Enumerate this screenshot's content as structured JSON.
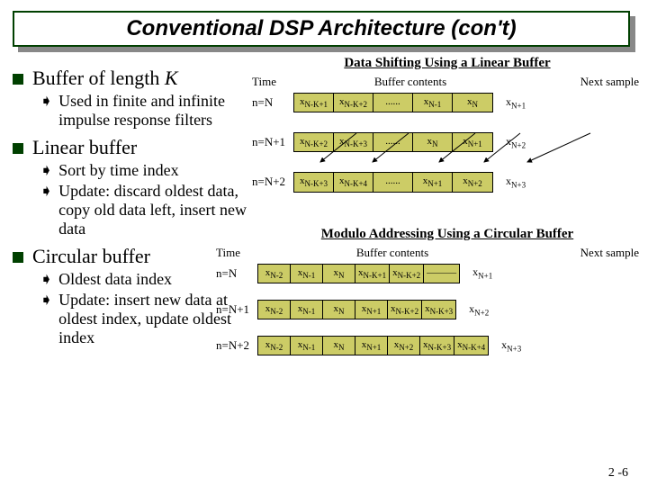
{
  "title": "Conventional DSP Architecture (con't)",
  "left": {
    "b1": {
      "title": "Buffer of length K",
      "sub1": "Used in finite and infinite impulse response filters"
    },
    "b2": {
      "title": "Linear buffer",
      "sub1": "Sort by time index",
      "sub2": "Update: discard oldest data, copy old data left, insert new data"
    },
    "b3": {
      "title": "Circular buffer",
      "sub1": "Oldest data index",
      "sub2": "Update: insert new data at oldest index, update oldest index"
    }
  },
  "linear": {
    "title": "Data Shifting Using a Linear Buffer",
    "h_time": "Time",
    "h_buf": "Buffer contents",
    "h_next": "Next sample",
    "rows": [
      {
        "t": "n=N",
        "c": [
          "x<sub>N-K+1</sub>",
          "x<sub>N-K+2</sub>",
          "......",
          "x<sub>N-1</sub>",
          "x<sub>N</sub>"
        ],
        "next": "x<sub>N+1</sub>"
      },
      {
        "t": "n=N+1",
        "c": [
          "x<sub>N-K+2</sub>",
          "x<sub>N-K+3</sub>",
          "......",
          "x<sub>N</sub>",
          "x<sub>N+1</sub>"
        ],
        "next": "x<sub>N+2</sub>"
      },
      {
        "t": "n=N+2",
        "c": [
          "x<sub>N-K+3</sub>",
          "x<sub>N-K+4</sub>",
          "......",
          "x<sub>N+1</sub>",
          "x<sub>N+2</sub>"
        ],
        "next": "x<sub>N+3</sub>"
      }
    ]
  },
  "circular": {
    "title": "Modulo Addressing Using a Circular Buffer",
    "h_time": "Time",
    "h_buf": "Buffer contents",
    "h_next": "Next sample",
    "rows": [
      {
        "t": "n=N",
        "c": [
          "x<sub>N-2</sub>",
          "x<sub>N-1</sub>",
          "x<sub>N</sub>",
          "x<sub>N-K+1</sub>",
          "x<sub>N-K+2</sub>",
          "———"
        ],
        "next": "x<sub>N+1</sub>"
      },
      {
        "t": "n=N+1",
        "c": [
          "x<sub>N-2</sub>",
          "x<sub>N-1</sub>",
          "x<sub>N</sub>",
          "x<sub>N+1</sub>",
          "x<sub>N-K+2</sub>",
          "x<sub>N-K+3</sub>"
        ],
        "next": "x<sub>N+2</sub>"
      },
      {
        "t": "n=N+2",
        "c": [
          "x<sub>N-2</sub>",
          "x<sub>N-1</sub>",
          "x<sub>N</sub>",
          "x<sub>N+1</sub>",
          "x<sub>N+2</sub>",
          "x<sub>N-K+3</sub>",
          "x<sub>N-K+4</sub>"
        ],
        "next": "x<sub>N+3</sub>"
      }
    ]
  },
  "page_num": "2 -6"
}
